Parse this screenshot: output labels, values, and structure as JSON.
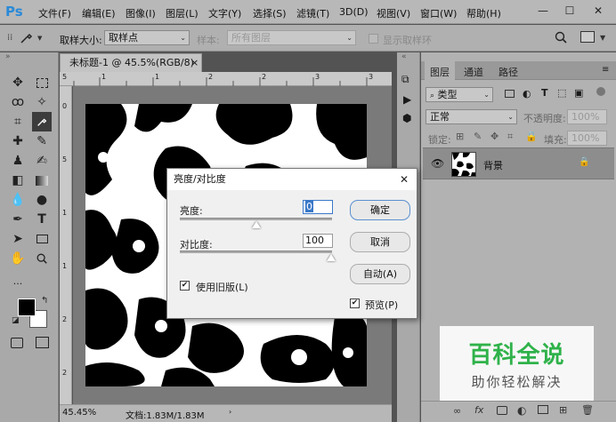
{
  "app": {
    "logo": "Ps"
  },
  "menu": [
    "文件(F)",
    "编辑(E)",
    "图像(I)",
    "图层(L)",
    "文字(Y)",
    "选择(S)",
    "滤镜(T)",
    "3D(D)",
    "视图(V)",
    "窗口(W)",
    "帮助(H)"
  ],
  "window_controls": {
    "minimize": "—",
    "maximize": "☐",
    "close": "✕"
  },
  "options": {
    "sample_size_label": "取样大小:",
    "sample_size_value": "取样点",
    "sample_label": "样本:",
    "sample_value": "所有图层",
    "show_ring_label": "显示取样环"
  },
  "document": {
    "tab_title": "未标题-1 @ 45.5%(RGB/8) *",
    "tab_close": "×",
    "zoom": "45.45%",
    "doc_info": "文档:1.83M/1.83M"
  },
  "ruler_top": [
    "5",
    "1",
    "1",
    "2",
    "2",
    "3",
    "3"
  ],
  "ruler_left": [
    "0",
    "5",
    "1",
    "1",
    "2",
    "2"
  ],
  "layers_panel": {
    "tabs": [
      "图层",
      "通道",
      "路径"
    ],
    "filter_label": "类型",
    "blend_mode": "正常",
    "opacity_label": "不透明度:",
    "opacity_value": "100%",
    "lock_label": "锁定:",
    "fill_label": "填充:",
    "fill_value": "100%",
    "layer_name": "背景"
  },
  "dialog": {
    "title": "亮度/对比度",
    "brightness_label": "亮度:",
    "brightness_value": "0",
    "brightness_level": 0,
    "contrast_label": "对比度:",
    "contrast_value": "100",
    "contrast_level": 100,
    "legacy_label": "使用旧版(L)",
    "legacy_checked": true,
    "ok": "确定",
    "cancel": "取消",
    "auto": "自动(A)",
    "preview_label": "预览(P)",
    "preview_checked": true,
    "close": "✕"
  },
  "watermark": {
    "title": "百科全说",
    "subtitle": "助你轻松解决",
    "color": "#2fb24a"
  }
}
